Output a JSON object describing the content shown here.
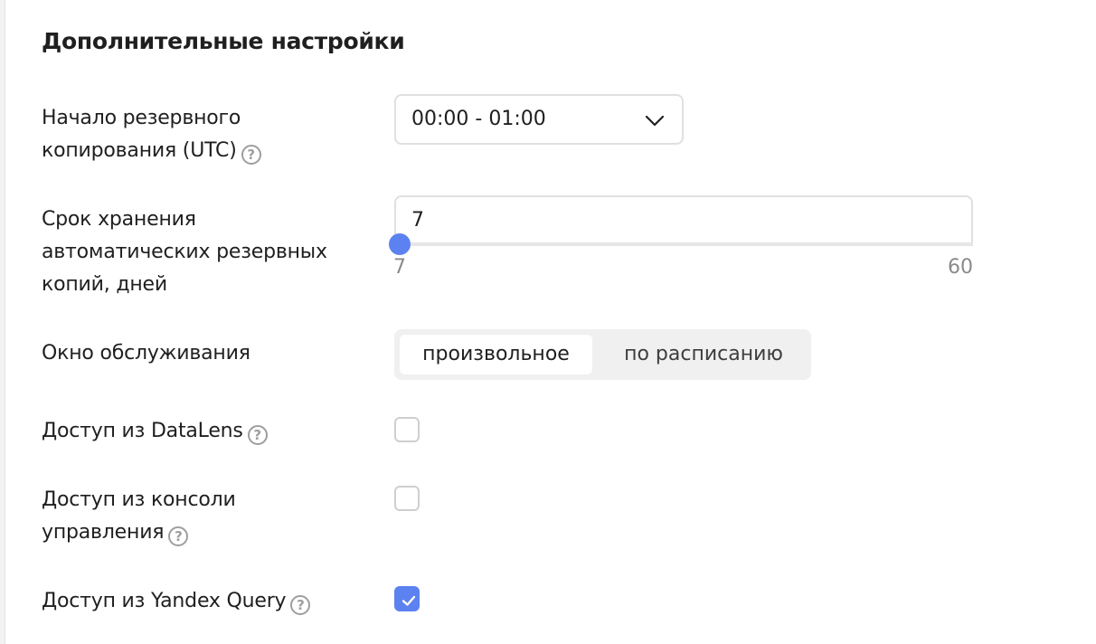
{
  "section": {
    "title": "Дополнительные настройки"
  },
  "backup_start": {
    "label_line1": "Начало резервного",
    "label_line2": "копирования (UTC)",
    "help_icon": "?",
    "value": "00:00 - 01:00"
  },
  "retention": {
    "label_line1": "Срок хранения",
    "label_line2": "автоматических резервных",
    "label_line3": "копий, дней",
    "value": "7",
    "min": "7",
    "max": "60",
    "slider_position_fraction": 0
  },
  "maintenance": {
    "label": "Окно обслуживания",
    "options": [
      "произвольное",
      "по расписанию"
    ],
    "selected": "произвольное"
  },
  "datalens": {
    "label": "Доступ из DataLens",
    "help_icon": "?",
    "checked": false
  },
  "console": {
    "label_line1": "Доступ из консоли",
    "label_line2": "управления",
    "help_icon": "?",
    "checked": false
  },
  "yandex_query": {
    "label": "Доступ из Yandex Query",
    "help_icon": "?",
    "checked": true
  },
  "colors": {
    "accent": "#5c81f0",
    "text": "#1f1f1f",
    "muted": "#8a8a8a",
    "border": "#e0e0e0"
  },
  "icons": {
    "help": "question-circle-icon",
    "chevron": "chevron-down-icon",
    "check": "check-icon"
  }
}
